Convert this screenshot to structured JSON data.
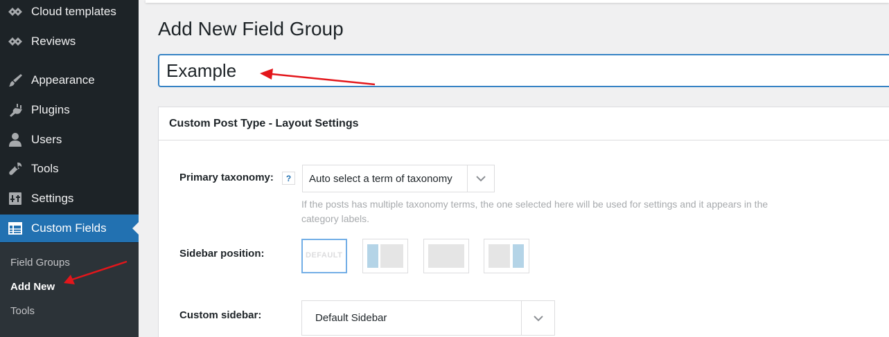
{
  "sidebar": {
    "items": [
      {
        "label": "Cloud templates",
        "icon": "elementor-icon"
      },
      {
        "label": "Reviews",
        "icon": "elementor-icon"
      },
      {
        "label": "Appearance",
        "icon": "paintbrush-icon"
      },
      {
        "label": "Plugins",
        "icon": "plugin-icon"
      },
      {
        "label": "Users",
        "icon": "user-icon"
      },
      {
        "label": "Tools",
        "icon": "wrench-icon"
      },
      {
        "label": "Settings",
        "icon": "settings-icon"
      },
      {
        "label": "Custom Fields",
        "icon": "table-icon",
        "active": true
      }
    ],
    "submenu": [
      {
        "label": "Field Groups"
      },
      {
        "label": "Add New",
        "current": true
      },
      {
        "label": "Tools"
      }
    ]
  },
  "main": {
    "page_title": "Add New Field Group",
    "title_input_value": "Example",
    "panel": {
      "title": "Custom Post Type - Layout Settings",
      "primary_taxonomy": {
        "label": "Primary taxonomy:",
        "help": "?",
        "value": "Auto select a term of taxonomy",
        "description": "If the posts has multiple taxonomy terms, the one selected here will be used for settings and it appears in the category labels."
      },
      "sidebar_position": {
        "label": "Sidebar position:",
        "default_text": "DEFAULT",
        "options": [
          "default",
          "left",
          "none",
          "right"
        ],
        "selected": "default"
      },
      "custom_sidebar": {
        "label": "Custom sidebar:",
        "value": "Default Sidebar"
      }
    }
  },
  "colors": {
    "sidebar_bg": "#1d2327",
    "submenu_bg": "#2c3338",
    "active_bg": "#2271b1",
    "input_focus": "#3582c4",
    "annotation_arrow": "#e3161b"
  }
}
